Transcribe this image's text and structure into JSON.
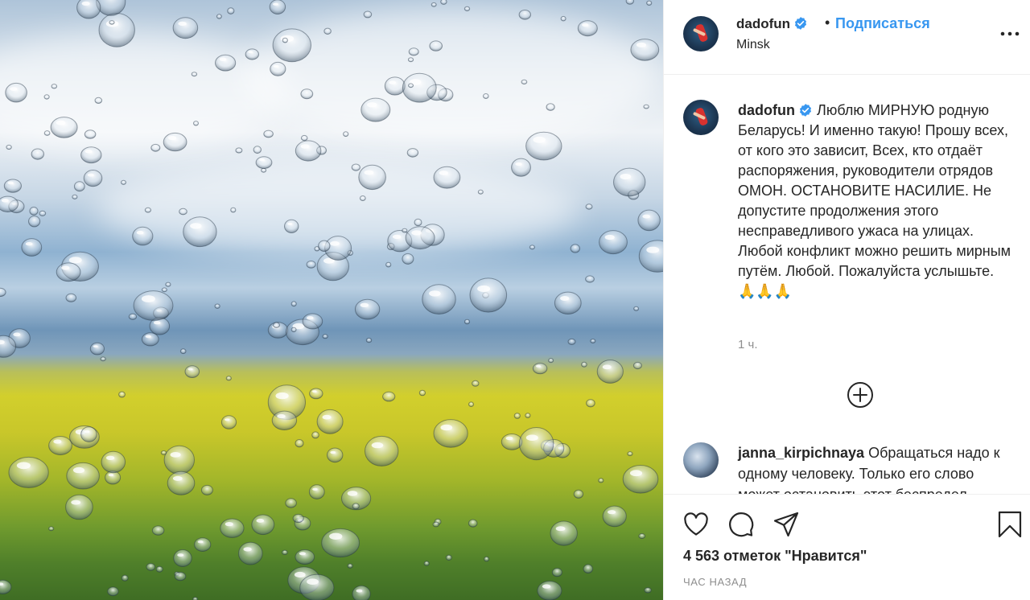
{
  "post": {
    "image_alt": "",
    "author": {
      "username": "dadofun",
      "verified": true,
      "location": "Minsk",
      "separator": "•",
      "follow_label": "Подписаться"
    },
    "caption": {
      "username": "dadofun",
      "text": "Люблю МИРНУЮ родную Беларусь! И именно такую! Прошу всех, от кого это зависит, Всех, кто отдаёт распоряжения, руководители отрядов ОМОН. ОСТАНОВИТЕ НАСИЛИЕ. Не допустите продолжения этого несправедливого ужаса на улицах. Любой конфликт можно решить мирным путём. Любой. Пожалуйста услышьте.\n🙏🙏🙏",
      "time": "1 ч."
    },
    "comments": [
      {
        "username": "janna_kirpichnaya",
        "text": "Обращаться надо к одному человеку. Только его слово может остановить этот беспредел"
      }
    ],
    "likes_text": "4 563 отметок \"Нравится\"",
    "posted_ago": "ЧАС НАЗАД"
  },
  "icons": {
    "more": "more-options-icon",
    "load_more": "plus-circle-icon",
    "like": "heart-icon",
    "comment": "comment-icon",
    "share": "share-icon",
    "save": "bookmark-icon",
    "verified": "verified-badge-icon"
  },
  "colors": {
    "link": "#3897f0",
    "verified": "#3897f0",
    "muted": "#8e8e8e",
    "text": "#262626"
  }
}
